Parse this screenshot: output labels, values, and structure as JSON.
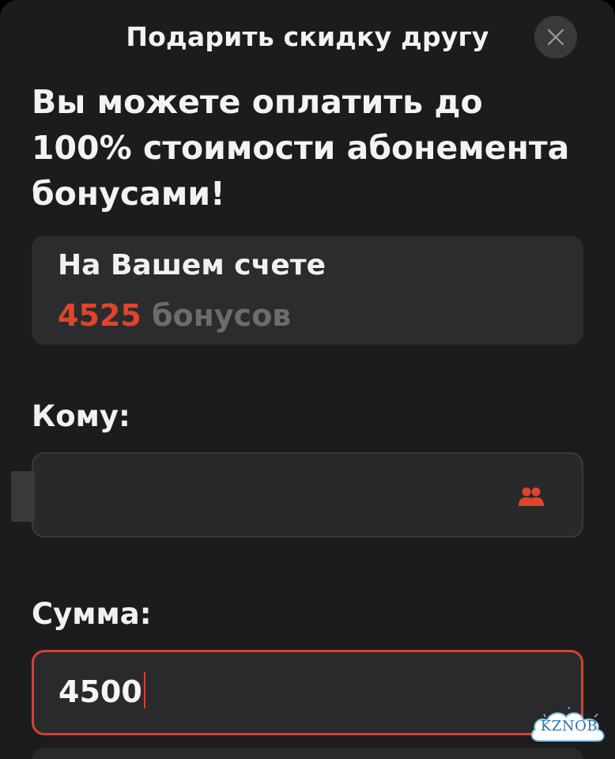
{
  "header": {
    "title": "Подарить скидку другу",
    "close_icon": "close-icon"
  },
  "headline": "Вы можете оплатить до 100% стоимости абонемента бонусами!",
  "balance": {
    "label": "На Вашем счете",
    "amount": "4525",
    "unit": "бонусов"
  },
  "recipient": {
    "label": "Кому:",
    "value": "",
    "icon": "contacts-icon"
  },
  "sum": {
    "label": "Сумма:",
    "value": "4500"
  },
  "watermark": "KZNOB",
  "colors": {
    "background": "#1c1c1e",
    "card": "#2c2c2e",
    "accent": "#e0452c",
    "muted": "#6c6c70",
    "text": "#f1f1f1"
  }
}
